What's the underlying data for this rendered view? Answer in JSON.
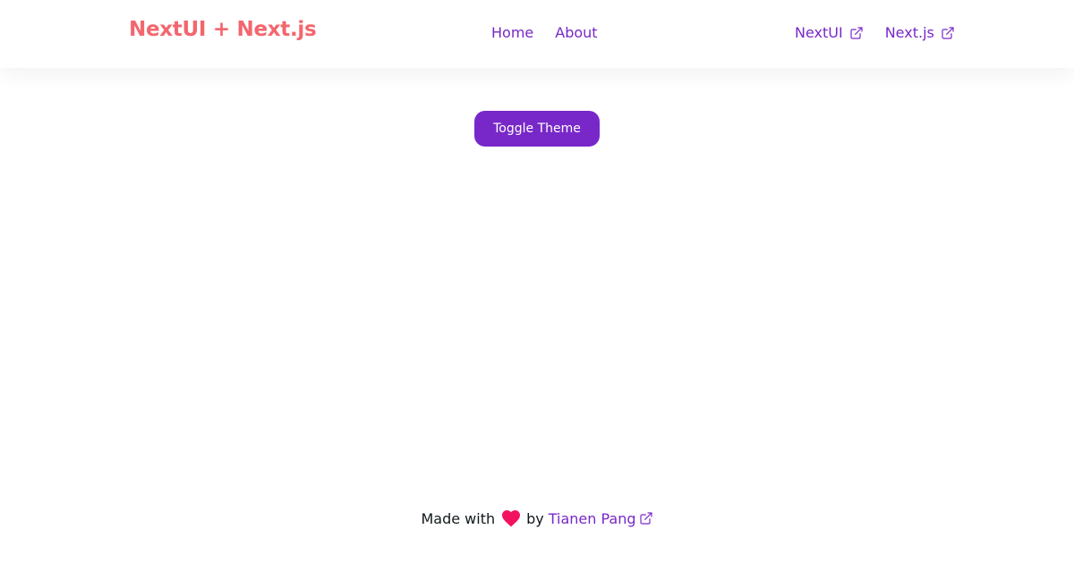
{
  "colors": {
    "brand": "#f3666e",
    "link": "#7828c8",
    "primary_button": "#7828c8",
    "text": "#11181c",
    "heart": "#f31260",
    "background": "#ffffff"
  },
  "navbar": {
    "brand": "NextUI + Next.js",
    "links": [
      {
        "label": "Home"
      },
      {
        "label": "About"
      }
    ],
    "external_links": [
      {
        "label": "NextUI",
        "icon": "external-link-icon"
      },
      {
        "label": "Next.js",
        "icon": "external-link-icon"
      }
    ]
  },
  "main": {
    "toggle_label": "Toggle Theme"
  },
  "footer": {
    "made_with": "Made with",
    "heart_icon": "heart-icon",
    "by": "by",
    "author": "Tianen Pang",
    "author_icon": "external-link-icon"
  }
}
